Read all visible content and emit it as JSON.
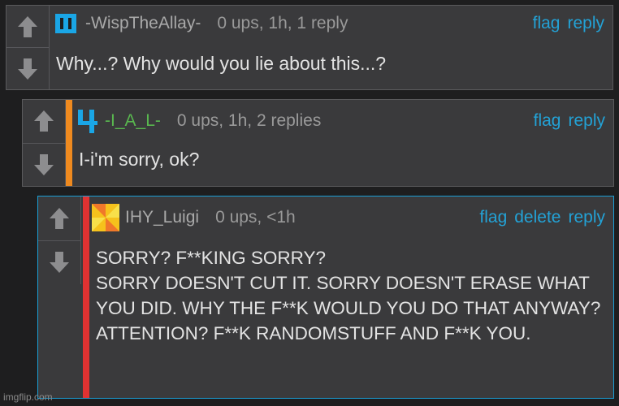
{
  "comments": [
    {
      "username": "-WispTheAllay-",
      "meta": "0 ups, 1h, 1 reply",
      "actions": [
        "flag",
        "reply"
      ],
      "text": "Why...? Why would you lie about this...?",
      "avatar_icon": "pause-bars-icon",
      "avatar_color": "#1aa6e6"
    },
    {
      "username": "-I_A_L-",
      "meta": "0 ups, 1h, 2 replies",
      "actions": [
        "flag",
        "reply"
      ],
      "text": "I-i'm sorry, ok?",
      "avatar_icon": "number-four-icon",
      "avatar_color": "#1aa6e6",
      "accent_color": "#ef8a1f"
    },
    {
      "username": "IHY_Luigi",
      "meta": "0 ups, <1h",
      "actions": [
        "flag",
        "delete",
        "reply"
      ],
      "text": "SORRY? F**KING SORRY?\nSORRY DOESN'T CUT IT. SORRY DOESN'T ERASE WHAT YOU DID. WHY THE F**K WOULD YOU DO THAT ANYWAY? ATTENTION? F**K RANDOMSTUFF AND F**K YOU.",
      "avatar_icon": "pinwheel-icon",
      "accent_color": "#e03232",
      "highlight_border": "#1a9fd6"
    }
  ],
  "watermark": "imgflip.com",
  "colors": {
    "link": "#23a2d6",
    "background": "#1e1e1f",
    "card": "#3a3a3c"
  }
}
